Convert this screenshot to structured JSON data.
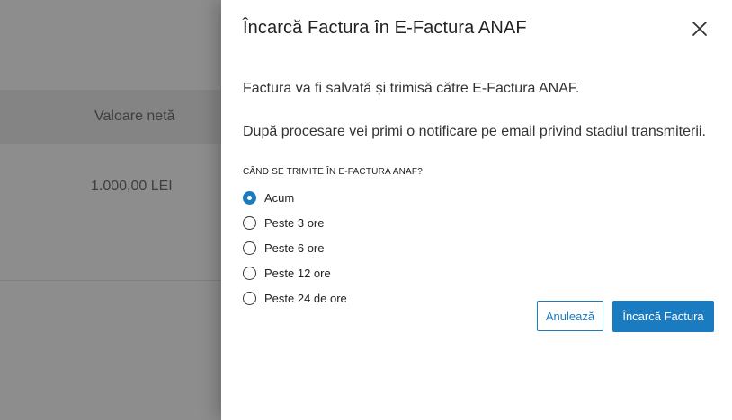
{
  "background": {
    "column_header": "Valoare netă",
    "cell_value": "1.000,00 LEI"
  },
  "panel": {
    "title": "Încarcă Factura în E-Factura ANAF",
    "close_icon": "close-icon",
    "message_1": "Factura va fi salvată și trimisă către E-Factura ANAF.",
    "message_2": "După procesare vei primi o notificare pe email privind stadiul transmiterii.",
    "schedule_label": "CÂND SE TRIMITE ÎN E-FACTURA ANAF?",
    "options": [
      {
        "label": "Acum",
        "checked": true
      },
      {
        "label": "Peste 3 ore",
        "checked": false
      },
      {
        "label": "Peste 6 ore",
        "checked": false
      },
      {
        "label": "Peste 12 ore",
        "checked": false
      },
      {
        "label": "Peste 24 de ore",
        "checked": false
      }
    ],
    "cancel_label": "Anulează",
    "submit_label": "Încarcă Factura",
    "accent_color": "#1a7bc0"
  }
}
